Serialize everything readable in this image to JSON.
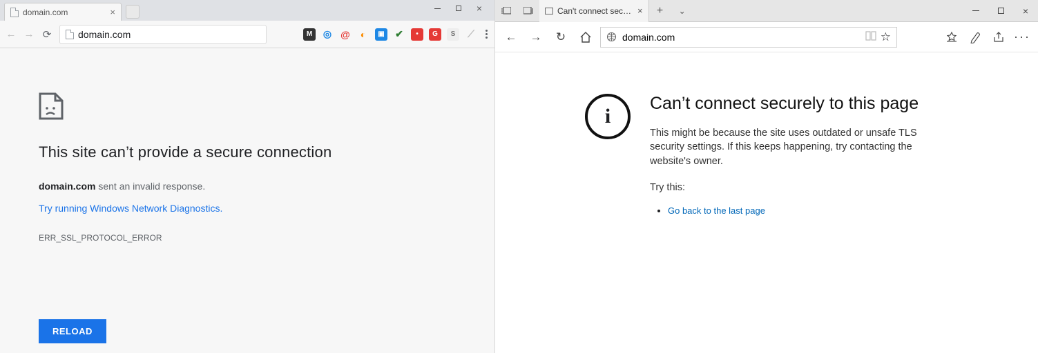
{
  "chrome": {
    "tab_title": "domain.com",
    "address": "domain.com",
    "heading": "This site can’t provide a secure connection",
    "msg_bold": "domain.com",
    "msg_rest": " sent an invalid response.",
    "diag_link": "Try running Windows Network Diagnostics.",
    "error_code": "ERR_SSL_PROTOCOL_ERROR",
    "reload_label": "RELOAD",
    "extensions": [
      {
        "bg": "#333333",
        "txt": "M"
      },
      {
        "bg": "none",
        "txt": "◎",
        "color": "#1e88e5"
      },
      {
        "bg": "none",
        "txt": "@",
        "color": "#e53935"
      },
      {
        "bg": "none",
        "txt": "◐",
        "color": "#fb8c00"
      },
      {
        "bg": "#1e88e5",
        "txt": "▣"
      },
      {
        "bg": "none",
        "txt": "✔",
        "color": "#2e7d32"
      },
      {
        "bg": "#e53935",
        "txt": "•"
      },
      {
        "bg": "#e53935",
        "txt": "G"
      },
      {
        "bg": "#eeeeee",
        "txt": "S",
        "color": "#777"
      },
      {
        "bg": "none",
        "txt": "⟋",
        "color": "#bdbdbd"
      }
    ]
  },
  "edge": {
    "tab_title": "Can't connect securely t",
    "address": "domain.com",
    "heading": "Can’t connect securely to this page",
    "body": "This might be because the site uses outdated or unsafe TLS security settings. If this keeps happening, try contacting the website's owner.",
    "try_label": "Try this:",
    "back_link": "Go back to the last page"
  }
}
